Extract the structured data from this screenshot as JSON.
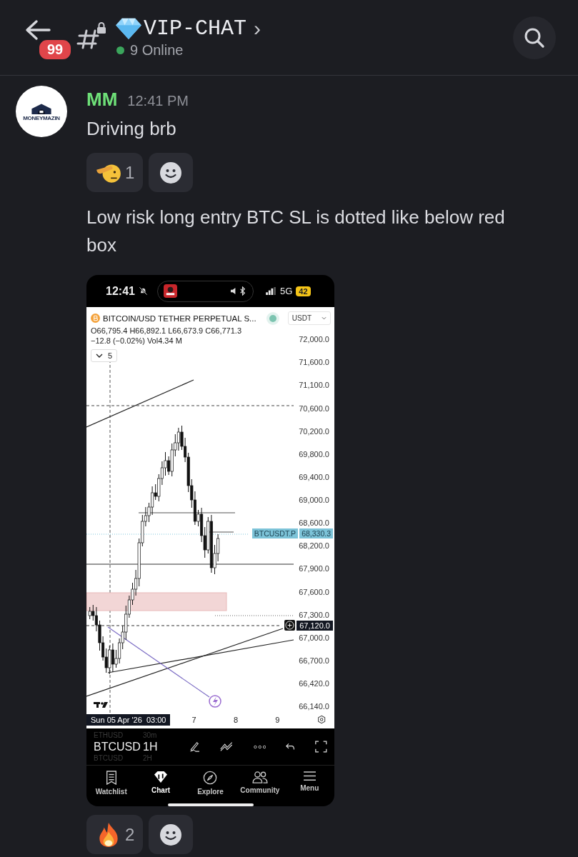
{
  "header": {
    "unread_badge": "99",
    "channel_title": "VIP-CHAT",
    "chevron": "›",
    "online": "9 Online"
  },
  "message": {
    "author": "MM",
    "time": "12:41 PM",
    "avatar_label": "MONEYMAZIN",
    "first_text": "Driving brb",
    "first_reactions": [
      {
        "kind": "salute",
        "count": "1"
      }
    ],
    "second_text": "Low risk long entry BTC SL is dotted like below red box",
    "attachment": {
      "status_bar": {
        "time": "12:41",
        "network": "5G",
        "battery": "42"
      },
      "chart": {
        "title": "BITCOIN/USD TETHER PERPETUAL S...",
        "currency": "USDT",
        "ohlc": "O66,795.4 H66,892.1 L66,673.9 C66,771.3",
        "change": "−12.8 (−0.02%) Vol4.34 M",
        "indicators_count": "5",
        "price_axis": [
          "72,000.0",
          "71,600.0",
          "71,100.0",
          "70,600.0",
          "70,200.0",
          "69,800.0",
          "69,400.0",
          "69,000.0",
          "68,600.0",
          "68,200.0",
          "67,900.0",
          "67,600.0",
          "67,300.0",
          "67,000.0",
          "66,700.0",
          "66,420.0",
          "66,140.0"
        ],
        "last_price": {
          "symbol": "BTCUSDT.P",
          "price": "68,330.3"
        },
        "crosshair_price": "67,120.0",
        "crosshair_time": "Sun 05 Apr '26  03:00",
        "time_axis": [
          "7",
          "8",
          "9"
        ]
      },
      "picker": [
        {
          "symbol": "ETHUSD",
          "interval": "30m",
          "selected": false
        },
        {
          "symbol": "BTCUSD",
          "interval": "1H",
          "selected": true
        },
        {
          "symbol": "BTCUSD",
          "interval": "2H",
          "selected": false
        }
      ],
      "nav": [
        {
          "kind": "watchlist",
          "label": "Watchlist",
          "selected": false
        },
        {
          "kind": "chart",
          "label": "Chart",
          "selected": true
        },
        {
          "kind": "explore",
          "label": "Explore",
          "selected": false
        },
        {
          "kind": "community",
          "label": "Community",
          "selected": false
        },
        {
          "kind": "menu",
          "label": "Menu",
          "selected": false
        }
      ]
    },
    "second_reactions": [
      {
        "kind": "fire",
        "count": "2"
      }
    ]
  }
}
